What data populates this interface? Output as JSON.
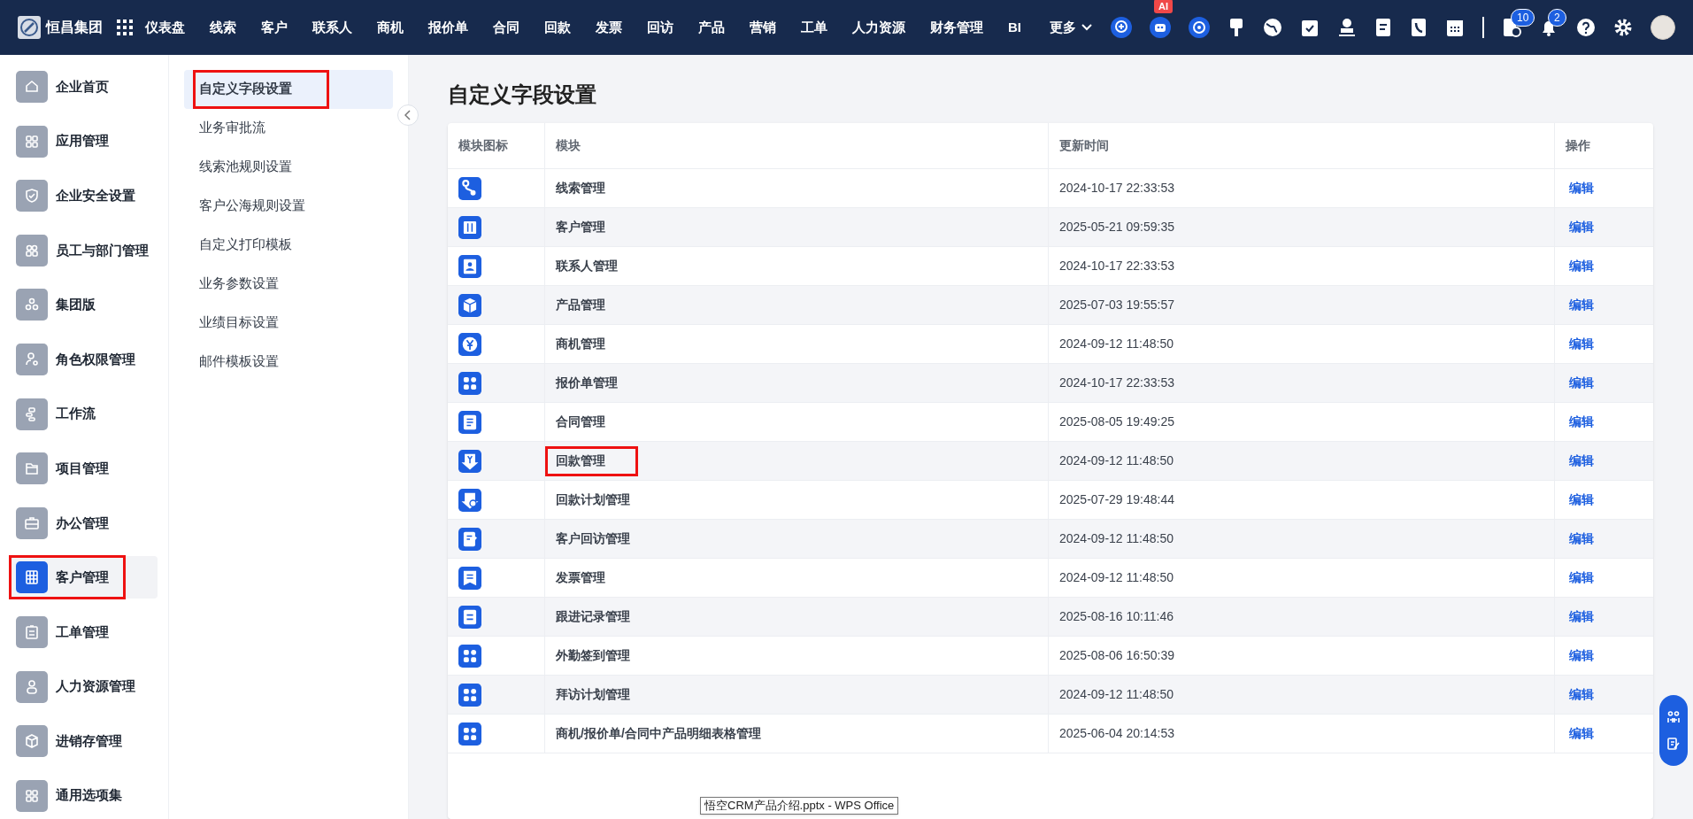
{
  "brand": {
    "name": "恒昌集团"
  },
  "nav": [
    {
      "label": "仪表盘"
    },
    {
      "label": "线索"
    },
    {
      "label": "客户"
    },
    {
      "label": "联系人"
    },
    {
      "label": "商机"
    },
    {
      "label": "报价单"
    },
    {
      "label": "合同"
    },
    {
      "label": "回款"
    },
    {
      "label": "发票"
    },
    {
      "label": "回访"
    },
    {
      "label": "产品"
    },
    {
      "label": "营销"
    },
    {
      "label": "工单"
    },
    {
      "label": "人力资源"
    },
    {
      "label": "财务管理"
    },
    {
      "label": "BI"
    }
  ],
  "more_menu": {
    "label": "更多"
  },
  "ai_badge": "AI",
  "badges": {
    "tasks": "10",
    "notifications": "2"
  },
  "sidebar": {
    "items": [
      {
        "label": "企业首页",
        "selected": false,
        "highlighted": false
      },
      {
        "label": "应用管理",
        "selected": false,
        "highlighted": false
      },
      {
        "label": "企业安全设置",
        "selected": false,
        "highlighted": false
      },
      {
        "label": "员工与部门管理",
        "selected": false,
        "highlighted": false
      },
      {
        "label": "集团版",
        "selected": false,
        "highlighted": false
      },
      {
        "label": "角色权限管理",
        "selected": false,
        "highlighted": false
      },
      {
        "label": "工作流",
        "selected": false,
        "highlighted": false
      },
      {
        "label": "项目管理",
        "selected": false,
        "highlighted": false
      },
      {
        "label": "办公管理",
        "selected": false,
        "highlighted": false
      },
      {
        "label": "客户管理",
        "selected": true,
        "highlighted": true
      },
      {
        "label": "工单管理",
        "selected": false,
        "highlighted": false
      },
      {
        "label": "人力资源管理",
        "selected": false,
        "highlighted": false
      },
      {
        "label": "进销存管理",
        "selected": false,
        "highlighted": false
      },
      {
        "label": "通用选项集",
        "selected": false,
        "highlighted": false
      }
    ]
  },
  "submenu": {
    "items": [
      {
        "label": "自定义字段设置",
        "selected": true,
        "highlighted": true
      },
      {
        "label": "业务审批流",
        "selected": false,
        "highlighted": false
      },
      {
        "label": "线索池规则设置",
        "selected": false,
        "highlighted": false
      },
      {
        "label": "客户公海规则设置",
        "selected": false,
        "highlighted": false
      },
      {
        "label": "自定义打印模板",
        "selected": false,
        "highlighted": false
      },
      {
        "label": "业务参数设置",
        "selected": false,
        "highlighted": false
      },
      {
        "label": "业绩目标设置",
        "selected": false,
        "highlighted": false
      },
      {
        "label": "邮件模板设置",
        "selected": false,
        "highlighted": false
      }
    ]
  },
  "page_title": "自定义字段设置",
  "table": {
    "columns": [
      "模块图标",
      "模块",
      "更新时间",
      "操作"
    ],
    "rows": [
      {
        "module": "线索管理",
        "updated": "2024-10-17 22:33:53",
        "action": "编辑",
        "highlighted": false
      },
      {
        "module": "客户管理",
        "updated": "2025-05-21 09:59:35",
        "action": "编辑",
        "highlighted": false
      },
      {
        "module": "联系人管理",
        "updated": "2024-10-17 22:33:53",
        "action": "编辑",
        "highlighted": false
      },
      {
        "module": "产品管理",
        "updated": "2025-07-03 19:55:57",
        "action": "编辑",
        "highlighted": false
      },
      {
        "module": "商机管理",
        "updated": "2024-09-12 11:48:50",
        "action": "编辑",
        "highlighted": false
      },
      {
        "module": "报价单管理",
        "updated": "2024-10-17 22:33:53",
        "action": "编辑",
        "highlighted": false
      },
      {
        "module": "合同管理",
        "updated": "2025-08-05 19:49:25",
        "action": "编辑",
        "highlighted": false
      },
      {
        "module": "回款管理",
        "updated": "2024-09-12 11:48:50",
        "action": "编辑",
        "highlighted": true
      },
      {
        "module": "回款计划管理",
        "updated": "2025-07-29 19:48:44",
        "action": "编辑",
        "highlighted": false
      },
      {
        "module": "客户回访管理",
        "updated": "2024-09-12 11:48:50",
        "action": "编辑",
        "highlighted": false
      },
      {
        "module": "发票管理",
        "updated": "2024-09-12 11:48:50",
        "action": "编辑",
        "highlighted": false
      },
      {
        "module": "跟进记录管理",
        "updated": "2025-08-16 10:11:46",
        "action": "编辑",
        "highlighted": false
      },
      {
        "module": "外勤签到管理",
        "updated": "2025-08-06 16:50:39",
        "action": "编辑",
        "highlighted": false
      },
      {
        "module": "拜访计划管理",
        "updated": "2024-09-12 11:48:50",
        "action": "编辑",
        "highlighted": false
      },
      {
        "module": "商机/报价单/合同中产品明细表格管理",
        "updated": "2025-06-04 20:14:53",
        "action": "编辑",
        "highlighted": false
      }
    ]
  },
  "tooltip": "悟空CRM产品介绍.pptx - WPS Office"
}
